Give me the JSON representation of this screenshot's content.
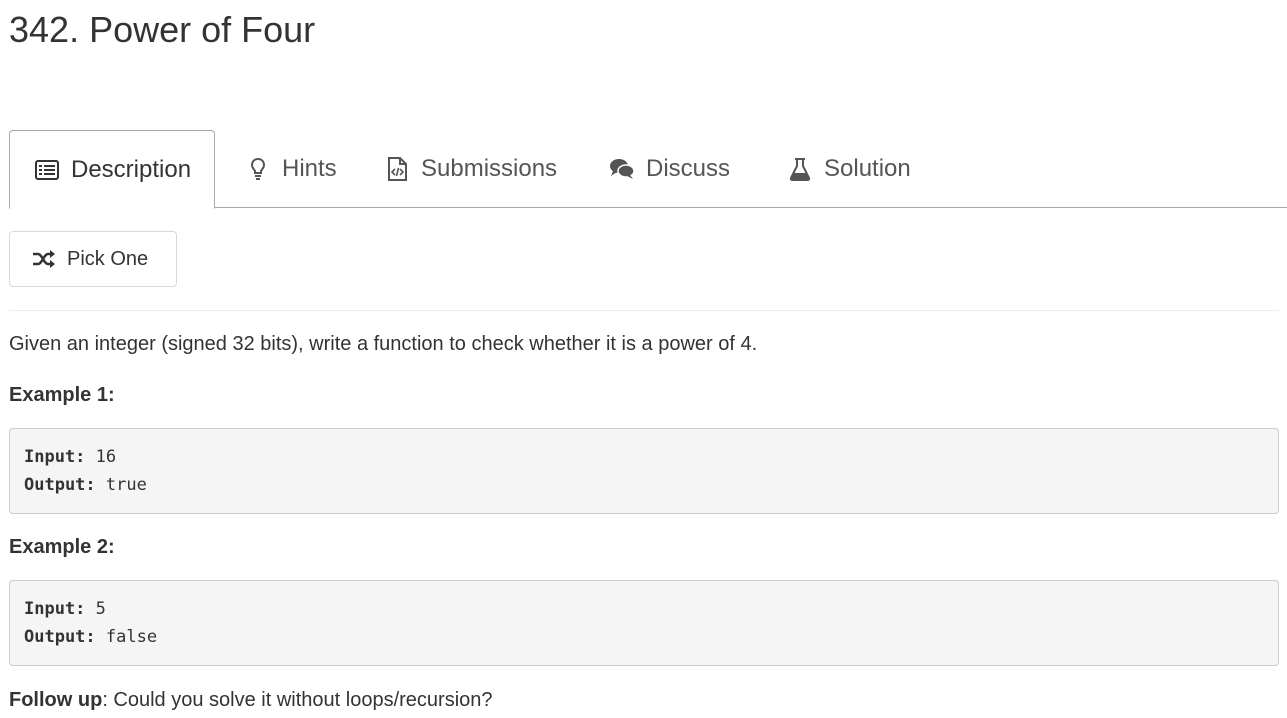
{
  "problem": {
    "title": "342. Power of Four"
  },
  "tabs": [
    {
      "label": "Description",
      "icon": "description-icon",
      "active": true
    },
    {
      "label": "Hints",
      "icon": "lightbulb-icon",
      "active": false
    },
    {
      "label": "Submissions",
      "icon": "code-file-icon",
      "active": false
    },
    {
      "label": "Discuss",
      "icon": "comments-icon",
      "active": false
    },
    {
      "label": "Solution",
      "icon": "flask-icon",
      "active": false
    }
  ],
  "pick_one": {
    "label": "Pick One",
    "icon": "shuffle-icon"
  },
  "content": {
    "description": "Given an integer (signed 32 bits), write a function to check whether it is a power of 4.",
    "examples": [
      {
        "heading": "Example 1:",
        "input_label": "Input:",
        "input_value": " 16",
        "output_label": "Output:",
        "output_value": " true"
      },
      {
        "heading": "Example 2:",
        "input_label": "Input:",
        "input_value": " 5",
        "output_label": "Output:",
        "output_value": " false"
      }
    ],
    "follow_up_label": "Follow up",
    "follow_up_text": ": Could you solve it without loops/recursion?"
  },
  "colors": {
    "text": "#333333",
    "tab_text": "#555555",
    "code_background": "#f5f5f5",
    "border": "#a8a8a8"
  }
}
